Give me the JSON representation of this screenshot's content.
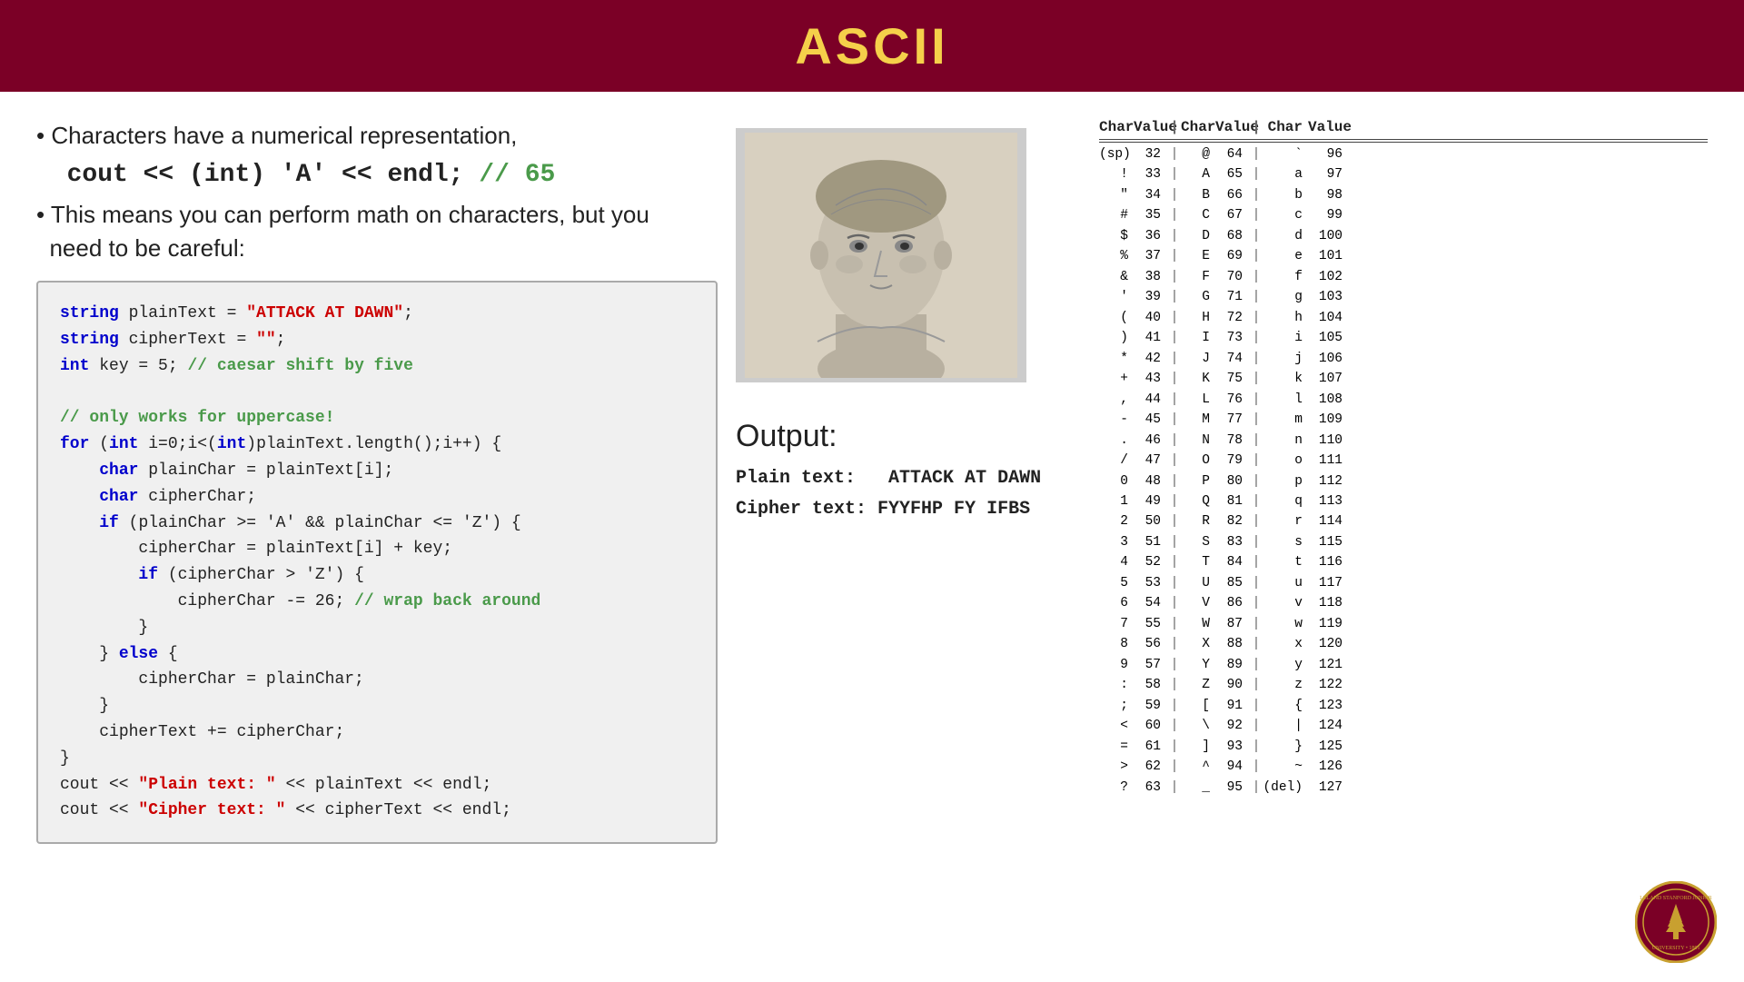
{
  "header": {
    "title": "ASCII"
  },
  "bullets": {
    "b1": "Characters have a numerical representation,",
    "b1_code": "cout << (int) 'A' << endl;",
    "b1_comment": " // 65",
    "b2": "This means you can perform math on characters, but you",
    "b2b": "need to be careful:"
  },
  "code": {
    "lines": [
      {
        "text": "string plainText = \"ATTACK AT DAWN\";",
        "type": "string_decl"
      },
      {
        "text": "string cipherText = \"\";",
        "type": "string_decl2"
      },
      {
        "text": "int key = 5; // caesar shift by five",
        "type": "int_decl"
      },
      {
        "text": "",
        "type": "blank"
      },
      {
        "text": "// only works for uppercase!",
        "type": "comment"
      },
      {
        "text": "for (int i=0;i<(int)plainText.length();i++) {",
        "type": "for"
      },
      {
        "text": "    char plainChar = plainText[i];",
        "type": "char_decl"
      },
      {
        "text": "    char cipherChar;",
        "type": "char_decl2"
      },
      {
        "text": "    if (plainChar >= 'A' && plainChar <= 'Z') {",
        "type": "if"
      },
      {
        "text": "        cipherChar = plainText[i] + key;",
        "type": "assign"
      },
      {
        "text": "        if (cipherChar > 'Z') {",
        "type": "if2"
      },
      {
        "text": "            cipherChar -= 26; // wrap back around",
        "type": "assign2"
      },
      {
        "text": "        }",
        "type": "brace"
      },
      {
        "text": "    } else {",
        "type": "else"
      },
      {
        "text": "        cipherChar = plainChar;",
        "type": "assign3"
      },
      {
        "text": "    }",
        "type": "brace2"
      },
      {
        "text": "    cipherText += cipherChar;",
        "type": "assign4"
      },
      {
        "text": "}",
        "type": "brace3"
      },
      {
        "text": "cout << \"Plain text:  \" << plainText << endl;",
        "type": "cout1"
      },
      {
        "text": "cout << \"Cipher text: \" << cipherText << endl;",
        "type": "cout2"
      }
    ]
  },
  "output": {
    "title": "Output:",
    "plain_label": "Plain text:",
    "plain_value": "ATTACK AT DAWN",
    "cipher_label": "Cipher text:",
    "cipher_value": "FYYFHP FY IFBS"
  },
  "ascii_table": {
    "headers": [
      "Char",
      "Value",
      "Char",
      "Value",
      "Char",
      "Value"
    ],
    "rows": [
      [
        "(sp)",
        "32",
        "@",
        "64",
        "`",
        "96"
      ],
      [
        "!",
        "33",
        "A",
        "65",
        "a",
        "97"
      ],
      [
        "\"",
        "34",
        "B",
        "66",
        "b",
        "98"
      ],
      [
        "#",
        "35",
        "C",
        "67",
        "c",
        "99"
      ],
      [
        "$",
        "36",
        "D",
        "68",
        "d",
        "100"
      ],
      [
        "%",
        "37",
        "E",
        "69",
        "e",
        "101"
      ],
      [
        "&",
        "38",
        "F",
        "70",
        "f",
        "102"
      ],
      [
        "'",
        "39",
        "G",
        "71",
        "g",
        "103"
      ],
      [
        "(",
        "40",
        "H",
        "72",
        "h",
        "104"
      ],
      [
        ")",
        "41",
        "I",
        "73",
        "i",
        "105"
      ],
      [
        "*",
        "42",
        "J",
        "74",
        "j",
        "106"
      ],
      [
        "+",
        "43",
        "K",
        "75",
        "k",
        "107"
      ],
      [
        ",",
        "44",
        "L",
        "76",
        "l",
        "108"
      ],
      [
        "-",
        "45",
        "M",
        "77",
        "m",
        "109"
      ],
      [
        ".",
        "46",
        "N",
        "78",
        "n",
        "110"
      ],
      [
        "/",
        "47",
        "O",
        "79",
        "o",
        "111"
      ],
      [
        "0",
        "48",
        "P",
        "80",
        "p",
        "112"
      ],
      [
        "1",
        "49",
        "Q",
        "81",
        "q",
        "113"
      ],
      [
        "2",
        "50",
        "R",
        "82",
        "r",
        "114"
      ],
      [
        "3",
        "51",
        "S",
        "83",
        "s",
        "115"
      ],
      [
        "4",
        "52",
        "T",
        "84",
        "t",
        "116"
      ],
      [
        "5",
        "53",
        "U",
        "85",
        "u",
        "117"
      ],
      [
        "6",
        "54",
        "V",
        "86",
        "v",
        "118"
      ],
      [
        "7",
        "55",
        "W",
        "87",
        "w",
        "119"
      ],
      [
        "8",
        "56",
        "X",
        "88",
        "x",
        "120"
      ],
      [
        "9",
        "57",
        "Y",
        "89",
        "y",
        "121"
      ],
      [
        ":",
        "58",
        "Z",
        "90",
        "z",
        "122"
      ],
      [
        ";",
        "59",
        "[",
        "91",
        "{",
        "123"
      ],
      [
        "<",
        "60",
        "\\",
        "92",
        "|",
        "124"
      ],
      [
        "=",
        "61",
        "]",
        "93",
        "}",
        "125"
      ],
      [
        ">",
        "62",
        "^",
        "94",
        "~",
        "126"
      ],
      [
        "?",
        "63",
        "_",
        "95",
        "(del)",
        "127"
      ]
    ]
  },
  "colors": {
    "header_bg": "#7b0026",
    "header_text": "#f5d04a",
    "keyword_blue": "#0000cc",
    "string_red": "#cc0000",
    "comment_green": "#4a9a4a"
  }
}
